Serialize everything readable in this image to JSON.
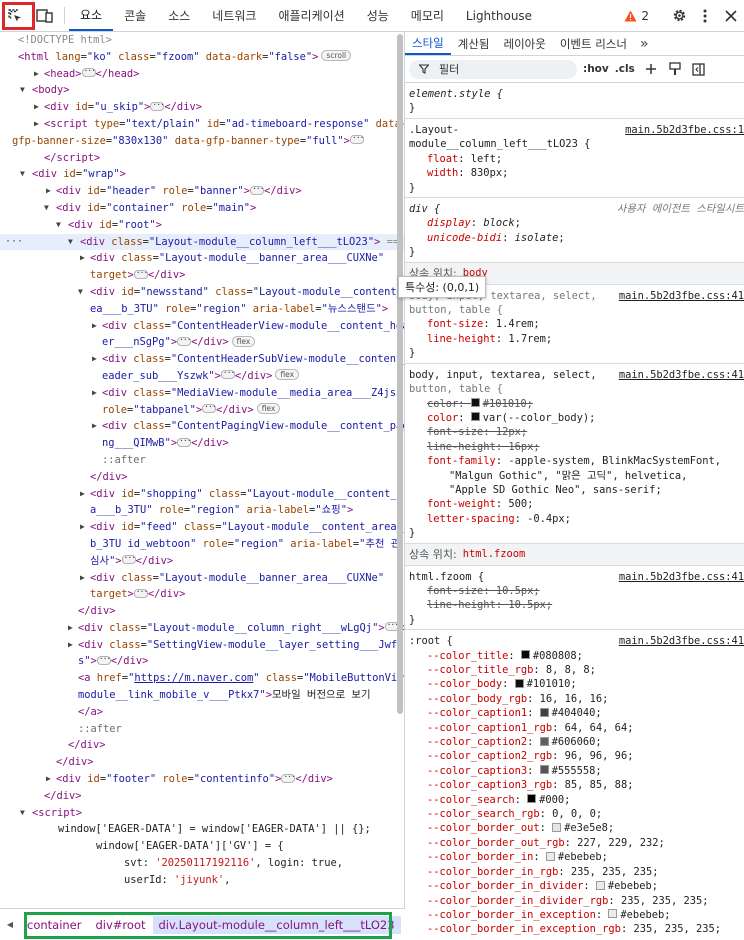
{
  "toolbar": {
    "tabs": [
      "요소",
      "콘솔",
      "소스",
      "네트워크",
      "애플리케이션",
      "성능",
      "메모리",
      "Lighthouse"
    ],
    "active_tab": 0,
    "warning_count": "2",
    "colors": {
      "accent": "#0b57d0",
      "highlight_red": "#e0282c",
      "highlight_green": "#1fa34a",
      "warning": "#f4511e"
    }
  },
  "elements": {
    "doctype": "<!DOCTYPE html>",
    "html_attrs": {
      "lang": "ko",
      "class": "fzoom",
      "data_dark": "false"
    },
    "scroll_badge": "scroll",
    "flex_badge": "flex",
    "selected_suffix": "== $0",
    "wrap_id": "wrap",
    "header": {
      "id": "header",
      "role": "banner"
    },
    "container": {
      "id": "container",
      "role": "main"
    },
    "root_id": "root",
    "skip_id": "u_skip",
    "script_attrs": {
      "type": "text/plain",
      "id": "ad-timeboard-response",
      "size_line1": "data-",
      "size_line2": "gfp-banner-size",
      "size_val": "830x130",
      "type_attr": "data-gfp-banner-type",
      "type_val": "full"
    },
    "column_left": "Layout-module__column_left___tLO23",
    "banner_area": "Layout-module__banner_area___CUXNe",
    "target_text": "target",
    "newsstand": {
      "id": "newsstand",
      "class_1": "Layout-module__content_ar",
      "class_2": "ea___b_3TU",
      "role": "region",
      "aria_label": "뉴스스탠드"
    },
    "content_header_1": "ContentHeaderView-module__content_head",
    "content_header_2": "er___nSgPg",
    "content_header_sub_1": "ContentHeaderSubView-module__content_h",
    "content_header_sub_2": "eader_sub___Yszwk",
    "media_1": "MediaView-module__media_area___Z4js3",
    "media_role": "tabpanel",
    "paging_1": "ContentPagingView-module__content_pagi",
    "paging_2": "ng___QIMwB",
    "after": "::after",
    "shopping": {
      "id": "shopping",
      "class_1": "Layout-module__content_are",
      "class_2": "a___b_3TU",
      "role": "region",
      "aria_label": "쇼핑"
    },
    "feed": {
      "id": "feed",
      "class_1": "Layout-module__content_area___",
      "class_2": "b_3TU id_webtoon",
      "role": "region",
      "aria_label_1": "추천 관",
      "aria_label_2": "심사"
    },
    "column_right": "Layout-module__column_right___wLgQj",
    "setting_1": "SettingView-module__layer_setting___JwfQ",
    "setting_2": "s",
    "mobile_link": {
      "href": "https://m.naver.com",
      "class_1": "MobileButtonView-",
      "class_2": "module__link_mobile_v___Ptkx7",
      "text": "모바일 버전으로 보기"
    },
    "footer": {
      "id": "footer",
      "role": "contentinfo"
    },
    "js_line1": "window['EAGER-DATA'] = window['EAGER-DATA'] || {};",
    "js_line2a": "window['EAGER-DATA']['GV'] = {",
    "js_svt_key": "svt: ",
    "js_svt_val": "'20250117192116'",
    "js_login": ",  login: true,",
    "js_userid_key": "userId: ",
    "js_userid_val": "'jiyunk'",
    "js_userid_end": ","
  },
  "breadcrumb": {
    "items": [
      "container",
      "div#root",
      "div.Layout-module__column_left___tLO23"
    ],
    "selected": 2
  },
  "styles": {
    "subtabs": [
      "스타일",
      "계산됨",
      "레이아웃",
      "이벤트 리스너"
    ],
    "more": "»",
    "filter_placeholder": "필터",
    "hov": ":hov",
    "cls": ".cls",
    "tooltip": "특수성: (0,0,1)",
    "element_style": "element.style {",
    "rule1": {
      "sel1": ".Layout-",
      "sel2": "module__column_left___tLO23 {",
      "src": "main.5b2d3fbe.css:1",
      "decls": [
        [
          "float",
          "left"
        ],
        [
          "width",
          "830px"
        ]
      ]
    },
    "rule2": {
      "sel": "div {",
      "src": "사용자 에이전트 스타일시트",
      "decls": [
        [
          "display",
          "block"
        ],
        [
          "unicode-bidi",
          "isolate"
        ]
      ]
    },
    "inherit1": {
      "label": "상속 위치: ",
      "target": "body"
    },
    "rule3": {
      "sel1": "body, input, textarea, select,",
      "sel2": "button, table {",
      "src": "main.5b2d3fbe.css:41",
      "decls": [
        [
          "font-size",
          "1.4rem"
        ],
        [
          "line-height",
          "1.7rem"
        ]
      ]
    },
    "rule4": {
      "sel1": "body, input, textarea, select,",
      "sel2": "button, table {",
      "src": "main.5b2d3fbe.css:41",
      "color_struck": "#101010",
      "color_val": "var(--color_body)",
      "font_size_struck": "12px",
      "line_height_struck": "16px",
      "font_family_1": "-apple-system, BlinkMacSystemFont,",
      "font_family_2": "\"Malgun Gothic\", \"맑은 고딕\", helvetica,",
      "font_family_3": "\"Apple SD Gothic Neo\", sans-serif",
      "font_weight": "500",
      "letter_spacing": "-0.4px"
    },
    "inherit2": {
      "label": "상속 위치: ",
      "target": "html.fzoom"
    },
    "rule5": {
      "sel": "html.fzoom {",
      "src": "main.5b2d3fbe.css:41",
      "font_size": "10.5px",
      "line_height": "10.5px"
    },
    "root_rule": {
      "sel": ":root {",
      "src": "main.5b2d3fbe.css:41",
      "vars": [
        {
          "name": "--color_title",
          "color": "#080808",
          "value": "#080808"
        },
        {
          "name": "--color_title_rgb",
          "color": "",
          "value": "8, 8, 8"
        },
        {
          "name": "--color_body",
          "color": "#101010",
          "value": "#101010"
        },
        {
          "name": "--color_body_rgb",
          "color": "",
          "value": "16, 16, 16"
        },
        {
          "name": "--color_caption1",
          "color": "#404040",
          "value": "#404040"
        },
        {
          "name": "--color_caption1_rgb",
          "color": "",
          "value": "64, 64, 64"
        },
        {
          "name": "--color_caption2",
          "color": "#606060",
          "value": "#606060"
        },
        {
          "name": "--color_caption2_rgb",
          "color": "",
          "value": "96, 96, 96"
        },
        {
          "name": "--color_caption3",
          "color": "#555558",
          "value": "#555558"
        },
        {
          "name": "--color_caption3_rgb",
          "color": "",
          "value": "85, 85, 88"
        },
        {
          "name": "--color_search",
          "color": "#000",
          "value": "#000"
        },
        {
          "name": "--color_search_rgb",
          "color": "",
          "value": "0, 0, 0"
        },
        {
          "name": "--color_border_out",
          "color": "#e3e5e8",
          "value": "#e3e5e8"
        },
        {
          "name": "--color_border_out_rgb",
          "color": "",
          "value": "227, 229, 232"
        },
        {
          "name": "--color_border_in",
          "color": "#ebebeb",
          "value": "#ebebeb"
        },
        {
          "name": "--color_border_in_rgb",
          "color": "",
          "value": "235, 235, 235"
        },
        {
          "name": "--color_border_in_divider",
          "color": "#ebebeb",
          "value": "#ebebeb"
        },
        {
          "name": "--color_border_in_divider_rgb",
          "color": "",
          "value": "235, 235, 235"
        },
        {
          "name": "--color_border_in_exception",
          "color": "#ebebeb",
          "value": "#ebebeb"
        },
        {
          "name": "--color_border_in_exception_rgb",
          "color": "",
          "value": "235, 235, 235"
        }
      ]
    }
  }
}
